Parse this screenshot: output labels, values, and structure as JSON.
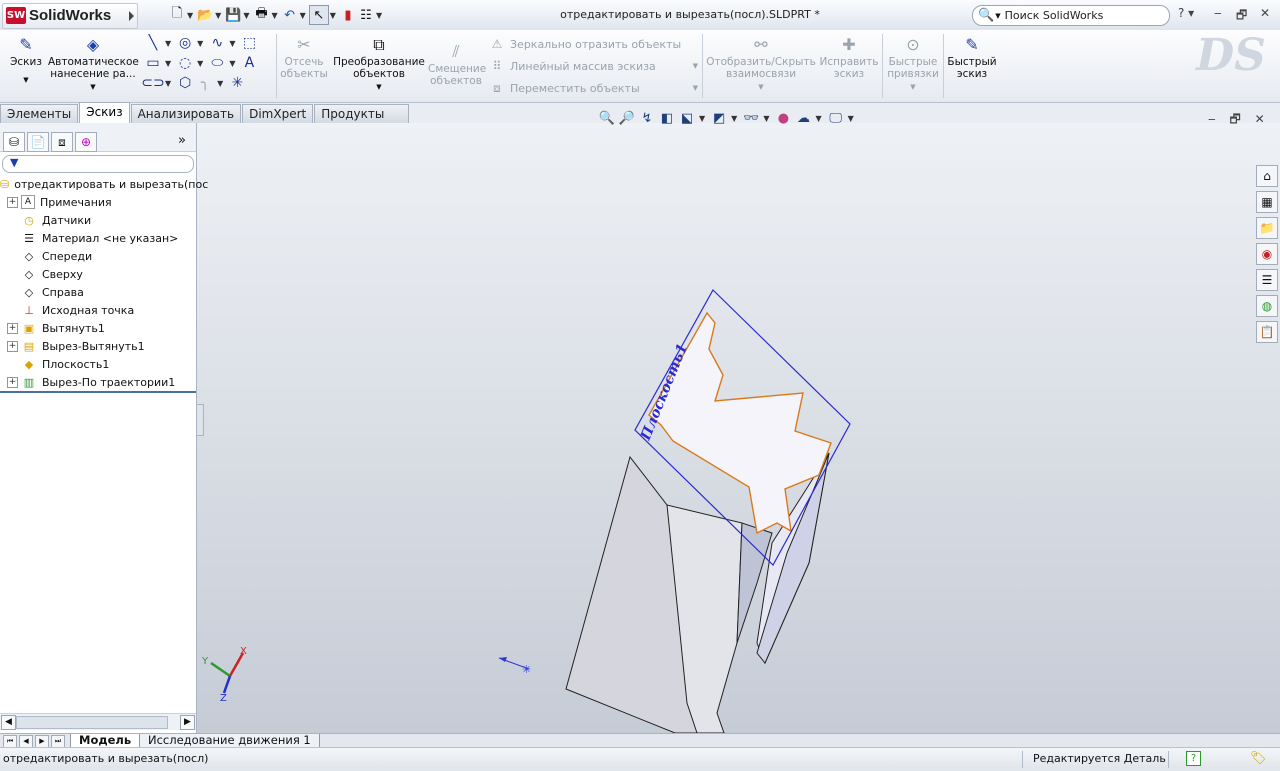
{
  "app": {
    "logo_text": "SolidWorks",
    "logo_badge": "SW"
  },
  "title": {
    "document": "отредактировать и вырезать(посл).SLDPRT *"
  },
  "search": {
    "placeholder": "Поиск SolidWorks"
  },
  "icons": {
    "new": "new-document-icon",
    "open": "open-folder-icon",
    "save": "save-icon",
    "print": "print-icon",
    "undo": "undo-icon",
    "select": "select-arrow-icon",
    "rebuild": "rebuild-traffic-light-icon",
    "options": "options-icon"
  },
  "commands": {
    "sketch": "Эскиз",
    "smart_dim": [
      "Автоматическое",
      "нанесение ра..."
    ],
    "trim": [
      "Отсечь",
      "объекты"
    ],
    "convert": [
      "Преобразование",
      "объектов"
    ],
    "offset": [
      "Смещение",
      "объектов"
    ],
    "mirror": "Зеркально отразить объекты",
    "linear_pattern": "Линейный массив эскиза",
    "move": "Переместить объекты",
    "relations": [
      "Отобразить/Скрыть",
      "взаимосвязи"
    ],
    "repair": [
      "Исправить",
      "эскиз"
    ],
    "quick_snaps": [
      "Быстрые",
      "привязки"
    ],
    "rapid_sketch": [
      "Быстрый",
      "эскиз"
    ]
  },
  "tabs": [
    {
      "label": "Элементы",
      "active": false
    },
    {
      "label": "Эскиз",
      "active": true
    },
    {
      "label": "Анализировать",
      "active": false
    },
    {
      "label": "DimXpert",
      "active": false
    },
    {
      "label": "Продукты Office",
      "active": false
    }
  ],
  "tree": {
    "root": "отредактировать и вырезать(пос",
    "items": [
      {
        "label": "Примечания",
        "expandable": true
      },
      {
        "label": "Датчики",
        "expandable": false
      },
      {
        "label": "Материал <не указан>",
        "expandable": false
      },
      {
        "label": "Спереди",
        "expandable": false
      },
      {
        "label": "Сверху",
        "expandable": false
      },
      {
        "label": "Справа",
        "expandable": false
      },
      {
        "label": "Исходная точка",
        "expandable": false
      },
      {
        "label": "Вытянуть1",
        "expandable": true
      },
      {
        "label": "Вырез-Вытянуть1",
        "expandable": true
      },
      {
        "label": "Плоскость1",
        "expandable": false
      },
      {
        "label": "Вырез-По траектории1",
        "expandable": true
      }
    ]
  },
  "viewport": {
    "plane_label": "Плоскость1",
    "triad": {
      "x": "X",
      "y": "Y",
      "z": "Z"
    },
    "colors": {
      "plane": "#2a2ad0",
      "sketch": "#d97a1a",
      "face": "#e8e8f4",
      "background": "#d4d9e1"
    }
  },
  "bottom_tabs": [
    {
      "label": "Модель",
      "active": true
    },
    {
      "label": "Исследование движения 1",
      "active": false
    }
  ],
  "status": {
    "left": "отредактировать и вырезать(посл)",
    "mode": "Редактируется Деталь",
    "help": "?"
  }
}
